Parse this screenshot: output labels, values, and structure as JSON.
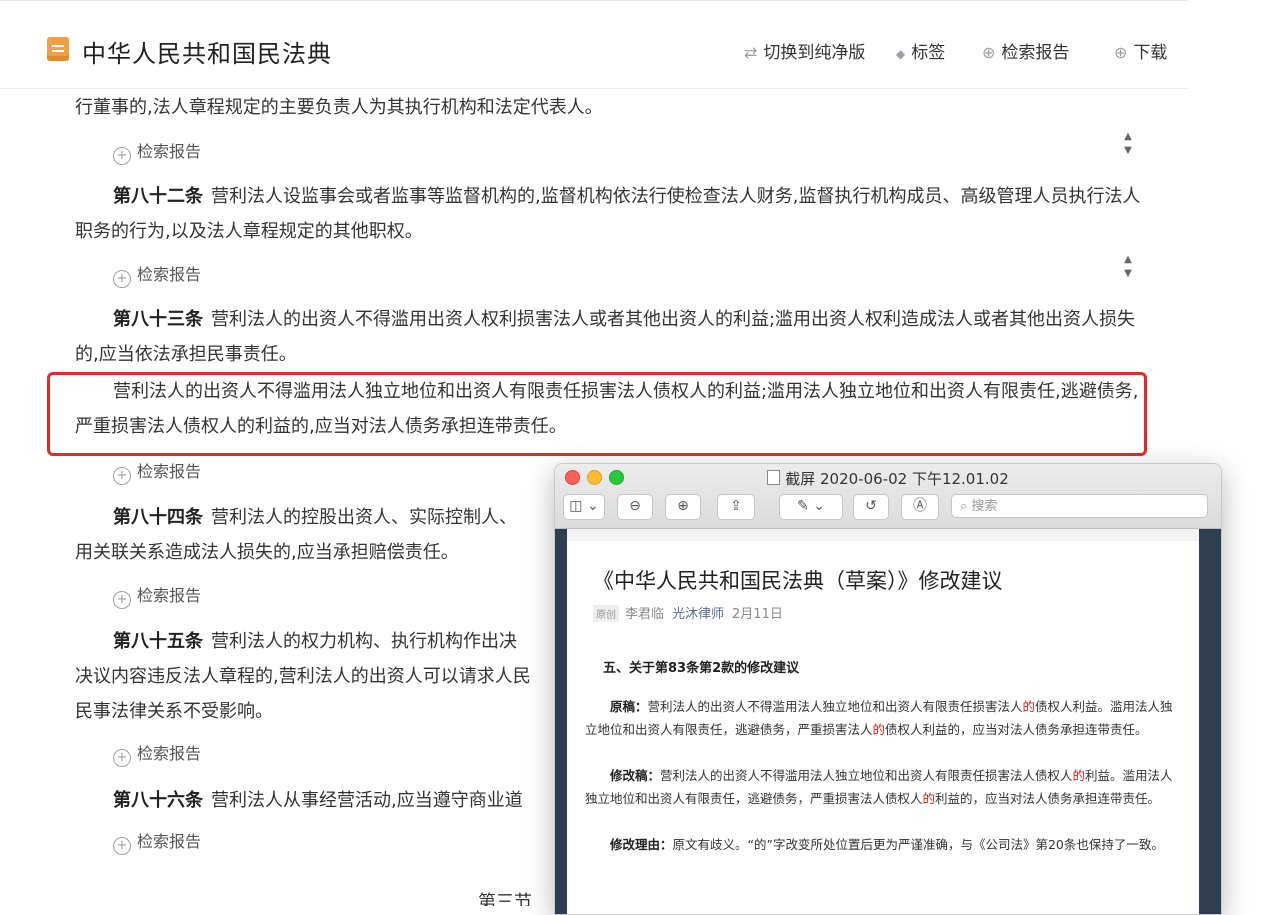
{
  "header": {
    "title": "中华人民共和国民法典",
    "actions": [
      {
        "icon": "swap-icon",
        "glyph": "⇄",
        "label": "切换到纯净版"
      },
      {
        "icon": "tag-icon",
        "glyph": "◆",
        "label": "标签"
      },
      {
        "icon": "plus-circle-icon",
        "glyph": "⊕",
        "label": "检索报告"
      },
      {
        "icon": "download-icon",
        "glyph": "⊕",
        "label": "下载"
      }
    ]
  },
  "content": {
    "para0": "行董事的,法人章程规定的主要负责人为其执行机构和法定代表人。",
    "search_report_label": "检索报告",
    "art82": {
      "num": "第八十二条",
      "text": "营利法人设监事会或者监事等监督机构的,监督机构依法行使检查法人财务,监督执行机构成员、高级管理人员执行法人职务的行为,以及法人章程规定的其他职权。"
    },
    "art83": {
      "num": "第八十三条",
      "text": "营利法人的出资人不得滥用出资人权利损害法人或者其他出资人的利益;滥用出资人权利造成法人或者其他出资人损失的,应当依法承担民事责任。"
    },
    "art83_p2": "营利法人的出资人不得滥用法人独立地位和出资人有限责任损害法人债权人的利益;滥用法人独立地位和出资人有限责任,逃避债务,严重损害法人债权人的利益的,应当对法人债务承担连带责任。",
    "art84": {
      "num": "第八十四条",
      "text": "营利法人的控股出资人、实际控制人、",
      "line2": "用关联关系造成法人损失的,应当承担赔偿责任。"
    },
    "art85": {
      "num": "第八十五条",
      "text": "营利法人的权力机构、执行机构作出决",
      "line2": "决议内容违反法人章程的,营利法人的出资人可以请求人民",
      "line3": "民事法律关系不受影响。"
    },
    "art86": {
      "num": "第八十六条",
      "text": "营利法人从事经营活动,应当遵守商业道"
    },
    "bottom_section": "第三节"
  },
  "preview": {
    "window_title": "截屏 2020-06-02 下午12.01.02",
    "search_placeholder": "搜索",
    "article_title": "《中华人民共和国民法典（草案）》修改建议",
    "original_tag": "原创",
    "author": "李君临",
    "account": "光沐律师",
    "date": "2月11日",
    "section_heading": "五、关于第83条第2款的修改建议",
    "orig_label": "原稿：",
    "orig_a": "营利法人的出资人不得滥用法人独立地位和出资人有限责任损害法人",
    "orig_b": "债权人利益。滥用法人独立地位和出资人有限责任，逃避债务，严重损害法人",
    "orig_c": "债权人利益的，应当对法人债务承担连带责任。",
    "rev_label": "修改稿：",
    "rev_a": "营利法人的出资人不得滥用法人独立地位和出资人有限责任损害法人债权人",
    "rev_b": "利益。滥用法人独立地位和出资人有限责任，逃避债务，严重损害法人债权人",
    "rev_c": "利益的，应当对法人债务承担连带责任。",
    "reason_label": "修改理由：",
    "reason_text": "原文有歧义。“的”字改变所处位置后更为严谨准确，与《公司法》第20条也保持了一致。",
    "de": "的"
  },
  "colors": {
    "highlight": "#e32a2a",
    "accent_red": "#e02020",
    "link": "#576b95"
  }
}
